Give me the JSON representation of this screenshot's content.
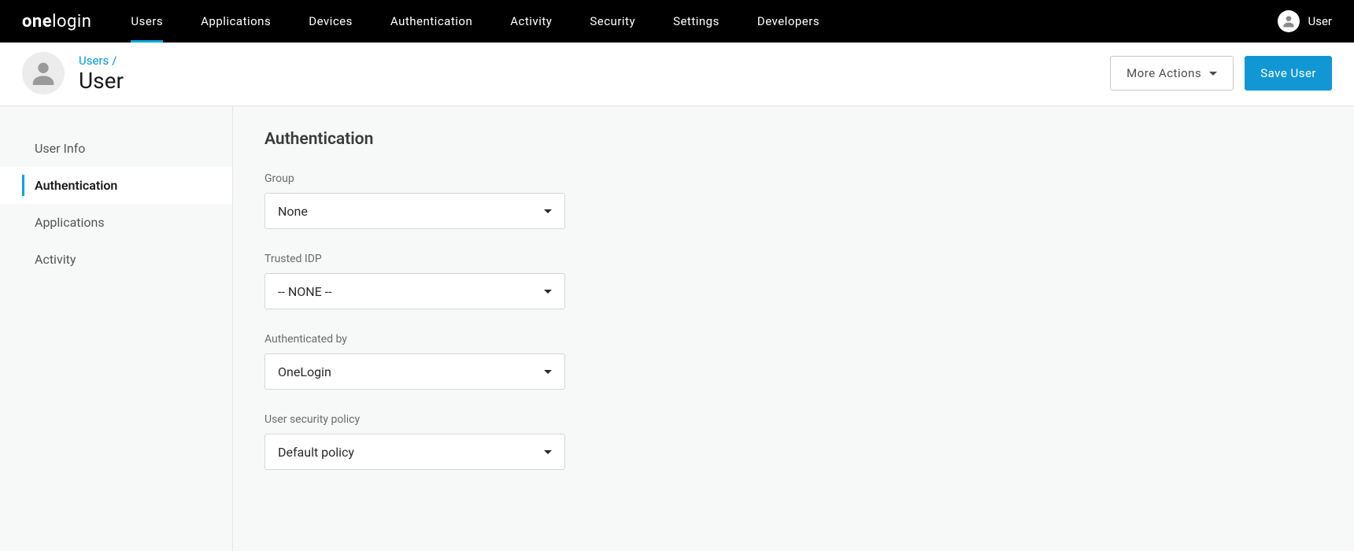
{
  "brand": {
    "part1": "one",
    "part2": "login"
  },
  "topnav": {
    "items": [
      {
        "label": "Users",
        "active": true
      },
      {
        "label": "Applications",
        "active": false
      },
      {
        "label": "Devices",
        "active": false
      },
      {
        "label": "Authentication",
        "active": false
      },
      {
        "label": "Activity",
        "active": false
      },
      {
        "label": "Security",
        "active": false
      },
      {
        "label": "Settings",
        "active": false
      },
      {
        "label": "Developers",
        "active": false
      }
    ],
    "user_label": "User"
  },
  "header": {
    "breadcrumb_link": "Users",
    "breadcrumb_sep": "/",
    "title": "User",
    "more_actions_label": "More Actions",
    "save_label": "Save User"
  },
  "sidebar": {
    "items": [
      {
        "label": "User Info",
        "active": false
      },
      {
        "label": "Authentication",
        "active": true
      },
      {
        "label": "Applications",
        "active": false
      },
      {
        "label": "Activity",
        "active": false
      }
    ]
  },
  "content": {
    "section_title": "Authentication",
    "fields": {
      "group": {
        "label": "Group",
        "value": "None"
      },
      "trusted_idp": {
        "label": "Trusted IDP",
        "value": "-- NONE --"
      },
      "authenticated_by": {
        "label": "Authenticated by",
        "value": "OneLogin"
      },
      "user_security_policy": {
        "label": "User security policy",
        "value": "Default policy"
      }
    }
  },
  "colors": {
    "accent": "#00a7e1",
    "primary_button": "#1297d5",
    "link": "#0099d6"
  }
}
